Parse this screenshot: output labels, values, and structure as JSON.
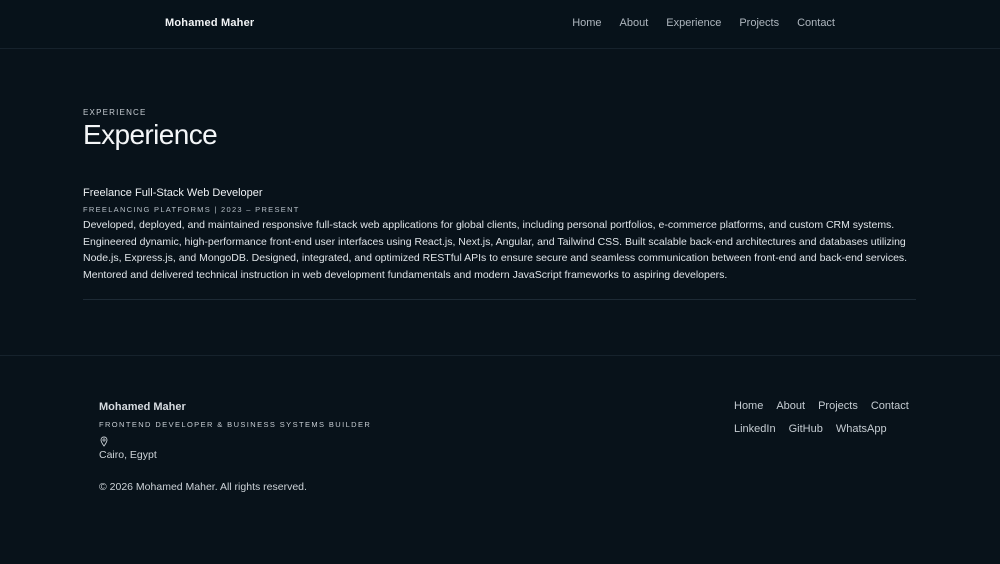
{
  "header": {
    "brand": "Mohamed Maher",
    "nav": [
      "Home",
      "About",
      "Experience",
      "Projects",
      "Contact"
    ]
  },
  "section": {
    "eyebrow": "EXPERIENCE",
    "title": "Experience"
  },
  "experience": [
    {
      "title": "Freelance Full-Stack Web Developer",
      "meta": "FREELANCING PLATFORMS | 2023 – PRESENT",
      "description": "Developed, deployed, and maintained responsive full-stack web applications for global clients, including personal portfolios, e-commerce platforms, and custom CRM systems. Engineered dynamic, high-performance front-end user interfaces using React.js, Next.js, Angular, and Tailwind CSS. Built scalable back-end architectures and databases utilizing Node.js, Express.js, and MongoDB. Designed, integrated, and optimized RESTful APIs to ensure secure and seamless communication between front-end and back-end services. Mentored and delivered technical instruction in web development fundamentals and modern JavaScript frameworks to aspiring developers."
    }
  ],
  "footer": {
    "brand": "Mohamed Maher",
    "tagline": "FRONTEND DEVELOPER & BUSINESS SYSTEMS BUILDER",
    "location_icon": "map-pin-icon",
    "location": "Cairo, Egypt",
    "copyright": "© 2026 Mohamed Maher. All rights reserved.",
    "links": [
      "Home",
      "About",
      "Projects",
      "Contact"
    ],
    "social": [
      "LinkedIn",
      "GitHub",
      "WhatsApp"
    ]
  },
  "colors": {
    "background": "#08121a",
    "border": "#1d2a35",
    "text": "#e6eaee",
    "muted": "#aeb6be"
  }
}
